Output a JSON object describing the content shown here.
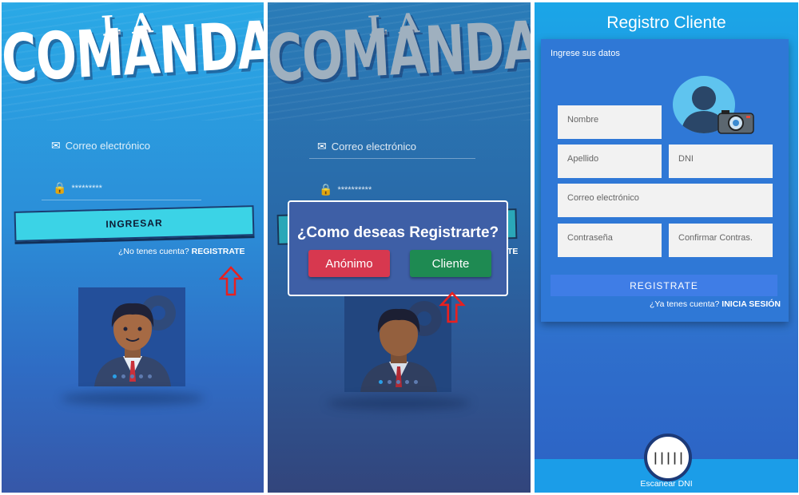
{
  "colors": {
    "accent_cyan": "#3bd3e6",
    "anon_red": "#d7384f",
    "client_green": "#1e8a52",
    "register_blue": "#3f7de6",
    "arrow_red": "#e8201f"
  },
  "login": {
    "logo_top": ".LA.",
    "logo_main": "COMANDA",
    "email_placeholder": "Correo electrónico",
    "password_value": "*********",
    "login_button": "INGRESAR",
    "no_account_text": "¿No tenes cuenta?",
    "register_link": "REGISTRATE"
  },
  "dialog": {
    "logo_top": ".LA.",
    "logo_main": "COMANDA",
    "email_placeholder": "Correo electrónico",
    "password_value": "**********",
    "title": "¿Como deseas Registrarte?",
    "anon_button": "Anónimo",
    "client_button": "Cliente",
    "partial_text": "TE"
  },
  "register": {
    "title": "Registro Cliente",
    "subtitle": "Ingrese sus datos",
    "name_placeholder": "Nombre",
    "lastname_placeholder": "Apellido",
    "dni_placeholder": "DNI",
    "email_placeholder": "Correo electrónico",
    "password_placeholder": "Contraseña",
    "confirm_placeholder": "Confirmar Contras.",
    "register_button": "REGISTRATE",
    "have_account_text": "¿Ya tenes cuenta?",
    "login_link": "INICIA SESIÓN",
    "scan_label": "Escanear DNI",
    "scan_icon": "barcode-icon"
  },
  "icons": {
    "email": "envelope-icon",
    "password": "lock-icon",
    "camera": "camera-icon",
    "arrow": "arrow-up-icon"
  }
}
